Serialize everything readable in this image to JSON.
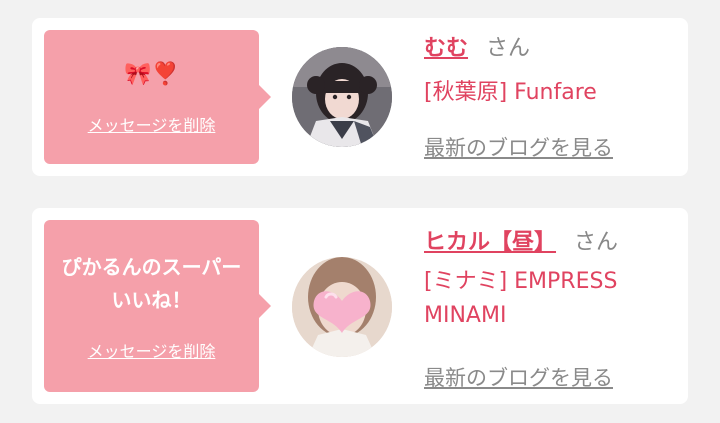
{
  "messages": [
    {
      "bubble_text": "🎀❣️",
      "delete_label": "メッセージを削除",
      "name": "むむ",
      "honorific": "さん",
      "shop": "[秋葉原] Funfare",
      "blog_link": "最新のブログを見る"
    },
    {
      "bubble_text": "ぴかるんのスーパーいいね！",
      "delete_label": "メッセージを削除",
      "name": "ヒカル【昼】",
      "honorific": "さん",
      "shop": "[ミナミ] EMPRESS MINAMI",
      "blog_link": "最新のブログを見る"
    }
  ]
}
